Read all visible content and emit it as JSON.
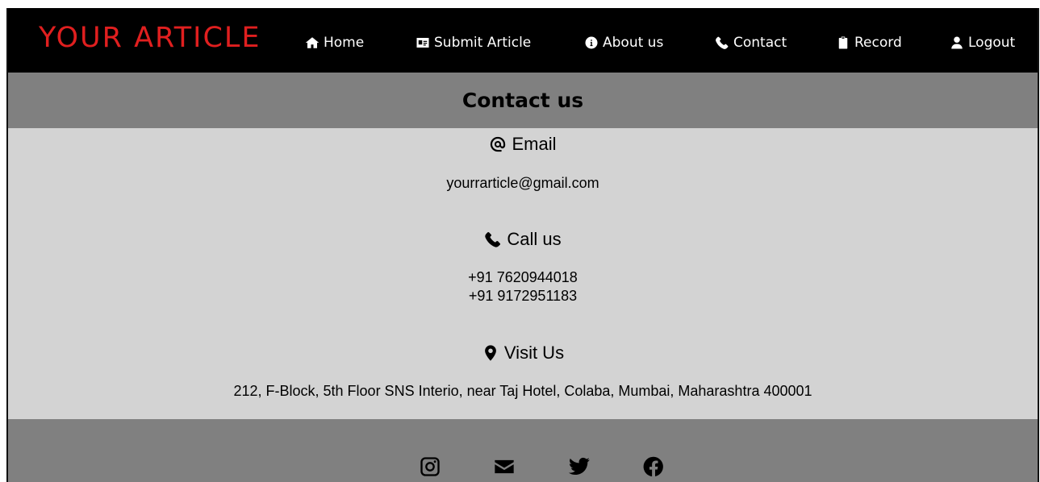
{
  "brand": "YOUR ARTICLE",
  "nav": {
    "items": [
      {
        "label": "Home",
        "icon": "home-icon"
      },
      {
        "label": "Submit Article",
        "icon": "id-card-icon"
      },
      {
        "label": "About us",
        "icon": "info-icon"
      },
      {
        "label": "Contact",
        "icon": "phone-icon"
      },
      {
        "label": "Record",
        "icon": "clipboard-icon"
      },
      {
        "label": "Logout",
        "icon": "user-icon"
      }
    ]
  },
  "page_title": "Contact us",
  "email": {
    "heading": "Email",
    "icon": "at-icon",
    "value": "yourrarticle@gmail.com"
  },
  "call": {
    "heading": "Call us",
    "icon": "phone-icon",
    "phones": [
      "+91 7620944018",
      "+91 9172951183"
    ]
  },
  "visit": {
    "heading": "Visit Us",
    "icon": "map-pin-icon",
    "address": "212, F-Block, 5th Floor SNS Interio, near Taj Hotel, Colaba, Mumbai, Maharashtra 400001"
  },
  "footer": {
    "social": [
      "instagram-icon",
      "envelope-icon",
      "twitter-icon",
      "facebook-icon"
    ]
  },
  "colors": {
    "nav_bg": "#000000",
    "brand": "#e01f1f",
    "title_bar": "#808080",
    "content_bg": "#d3d3d3",
    "footer_bg": "#808080"
  }
}
